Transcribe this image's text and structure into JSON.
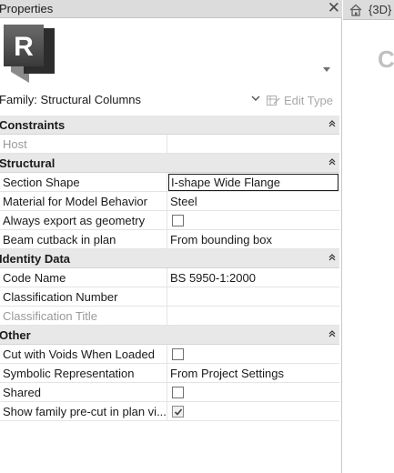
{
  "window": {
    "title": "Properties"
  },
  "type_selector": {
    "logo_letter": "R"
  },
  "family": {
    "label": "Family: Structural Columns",
    "edit_type": "Edit Type"
  },
  "sections": [
    {
      "title": "Constraints",
      "rows": [
        {
          "name": "Host",
          "value": "",
          "dim": true
        }
      ]
    },
    {
      "title": "Structural",
      "rows": [
        {
          "name": "Section Shape",
          "value": "I-shape Wide Flange",
          "editing": true
        },
        {
          "name": "Material for Model Behavior",
          "value": "Steel"
        },
        {
          "name": "Always export as geometry",
          "checkbox": true,
          "checked": false
        },
        {
          "name": "Beam cutback in plan",
          "value": "From bounding box"
        }
      ]
    },
    {
      "title": "Identity Data",
      "rows": [
        {
          "name": "Code Name",
          "value": "BS 5950-1:2000"
        },
        {
          "name": "Classification Number",
          "value": ""
        },
        {
          "name": "Classification Title",
          "value": "",
          "dim": true
        }
      ]
    },
    {
      "title": "Other",
      "rows": [
        {
          "name": "Cut with Voids When Loaded",
          "checkbox": true,
          "checked": false
        },
        {
          "name": "Symbolic Representation",
          "value": "From Project Settings"
        },
        {
          "name": "Shared",
          "checkbox": true,
          "checked": false
        },
        {
          "name": "Show family pre-cut in plan vi...",
          "checkbox": true,
          "checked": true
        }
      ]
    }
  ],
  "view_tab": {
    "label": "{3D}",
    "glyph": "C"
  },
  "icons": {
    "close": "close-icon",
    "home": "home-icon",
    "collapse": "collapse-icon",
    "edit_type": "edit-type-icon"
  },
  "colors": {
    "titlebar": "#dcdcdc",
    "section_header": "#e8e8e8"
  }
}
